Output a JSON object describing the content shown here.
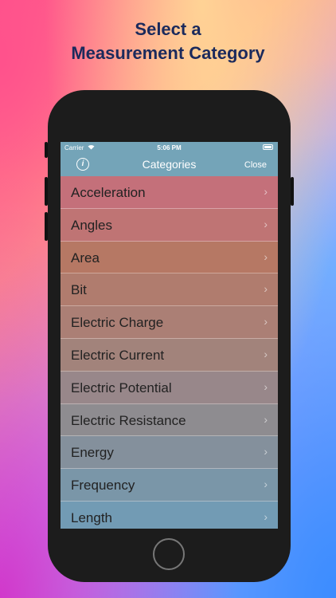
{
  "headline": {
    "line1": "Select a",
    "line2": "Measurement Category"
  },
  "status_bar": {
    "carrier": "Carrier",
    "wifi_icon": "wifi-icon",
    "time": "5:06 PM",
    "battery_icon": "battery-icon"
  },
  "nav": {
    "title": "Categories",
    "info_icon": "info-icon",
    "close_label": "Close"
  },
  "rows": [
    {
      "label": "Acceleration",
      "color": "#c4707a"
    },
    {
      "label": "Angles",
      "color": "#bf7474"
    },
    {
      "label": "Area",
      "color": "#b67864"
    },
    {
      "label": "Bit",
      "color": "#b07c6e"
    },
    {
      "label": "Electric Charge",
      "color": "#ab7f75"
    },
    {
      "label": "Electric Current",
      "color": "#a2837b"
    },
    {
      "label": "Electric Potential",
      "color": "#98878a"
    },
    {
      "label": "Electric Resistance",
      "color": "#8e8c90"
    },
    {
      "label": "Energy",
      "color": "#84909c"
    },
    {
      "label": "Frequency",
      "color": "#7a96a8"
    },
    {
      "label": "Length",
      "color": "#729bb4"
    }
  ],
  "chevron": "›"
}
